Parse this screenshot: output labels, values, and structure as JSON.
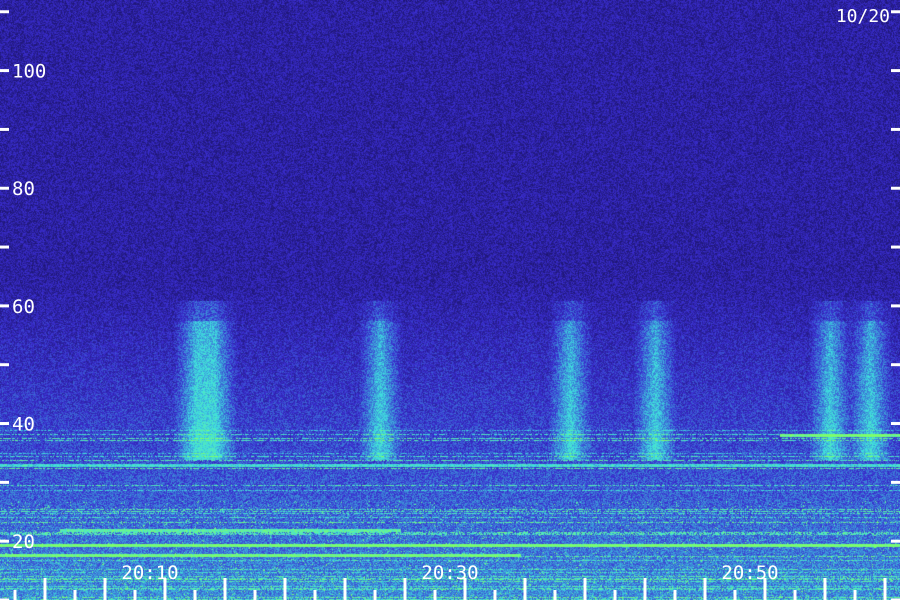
{
  "chart_data": {
    "type": "heatmap",
    "title": "",
    "xlabel": "",
    "ylabel": "",
    "date_label": "10/20",
    "y_ticks": [
      {
        "value": 20,
        "label": "20"
      },
      {
        "value": 40,
        "label": "40"
      },
      {
        "value": 60,
        "label": "60"
      },
      {
        "value": 80,
        "label": "80"
      },
      {
        "value": 100,
        "label": "100"
      }
    ],
    "y_minor_ticks": [
      10,
      30,
      50,
      70,
      90,
      110
    ],
    "ylim": [
      10,
      112
    ],
    "x_ticks": [
      {
        "value": "20:10",
        "label": "20:10"
      },
      {
        "value": "20:30",
        "label": "20:30"
      },
      {
        "value": "20:50",
        "label": "20:50"
      }
    ],
    "x_tick_times": [
      "20:01",
      "20:03",
      "20:05",
      "20:07",
      "20:09",
      "20:11",
      "20:13",
      "20:15",
      "20:17",
      "20:19",
      "20:21",
      "20:23",
      "20:25",
      "20:27",
      "20:29",
      "20:31",
      "20:33",
      "20:35",
      "20:37",
      "20:39",
      "20:41",
      "20:43",
      "20:45",
      "20:47",
      "20:49",
      "20:51",
      "20:53",
      "20:55",
      "20:57",
      "20:59"
    ],
    "xlim": [
      "20:00",
      "21:00"
    ],
    "colors": {
      "low": "#0a0530",
      "mid": "#3a2dd0",
      "high": "#3fe0e0",
      "peak": "#7dff6a"
    }
  }
}
